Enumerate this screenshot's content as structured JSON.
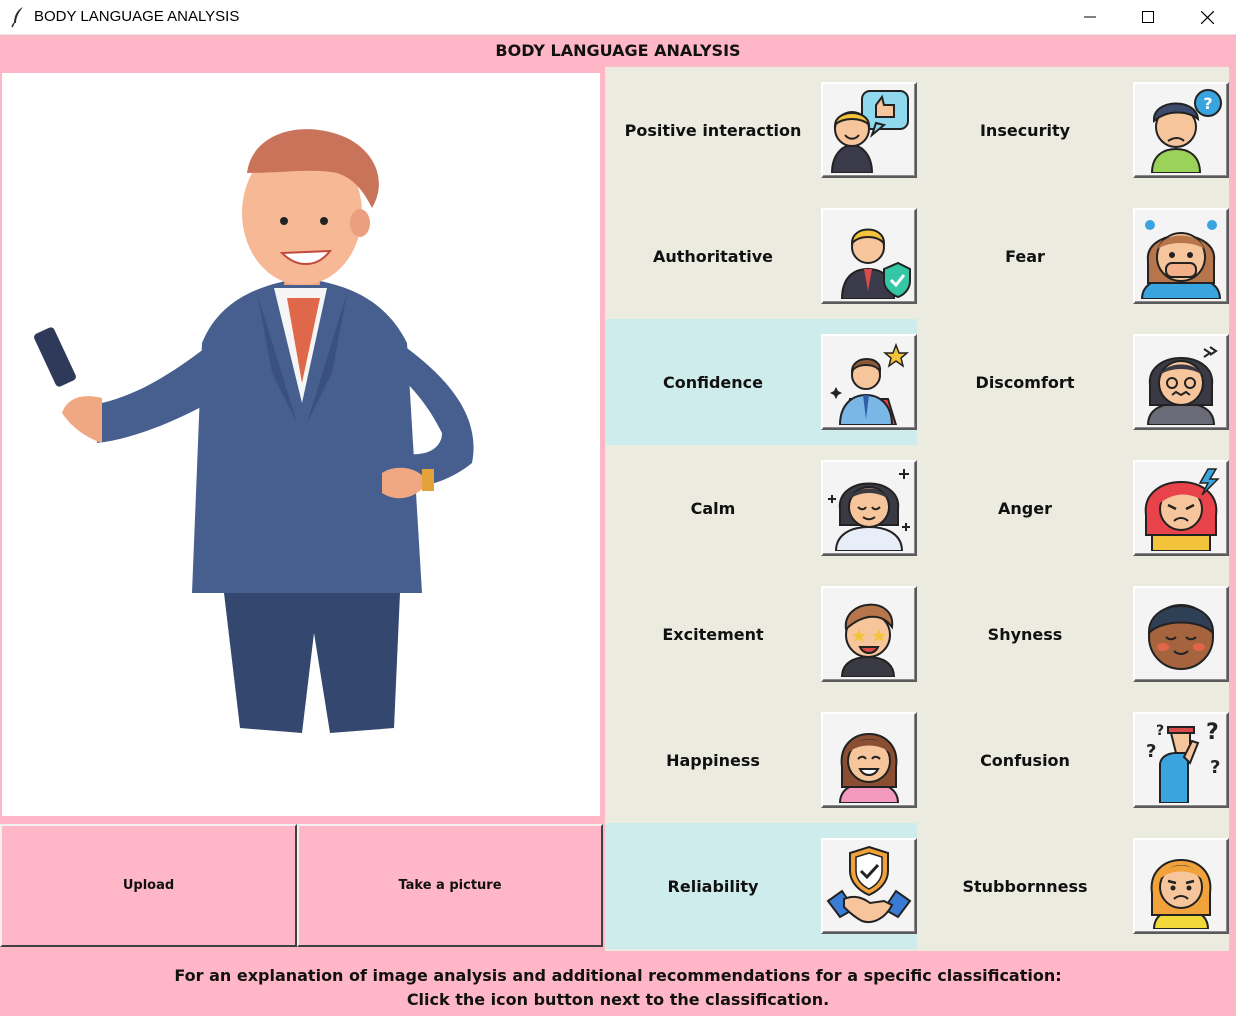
{
  "window": {
    "title": "BODY LANGUAGE ANALYSIS"
  },
  "app": {
    "header": "BODY LANGUAGE ANALYSIS"
  },
  "image_panel": {
    "icon": "businessman-illustration"
  },
  "buttons": {
    "upload": "Upload",
    "take_picture": "Take a picture"
  },
  "classifications": [
    {
      "label": "Positive interaction",
      "icon": "thumbs-up-person-icon",
      "highlighted": false
    },
    {
      "label": "Insecurity",
      "icon": "question-person-icon",
      "highlighted": false
    },
    {
      "label": "Authoritative",
      "icon": "shield-businessman-icon",
      "highlighted": false
    },
    {
      "label": "Fear",
      "icon": "scared-girl-icon",
      "highlighted": false
    },
    {
      "label": "Confidence",
      "icon": "star-businessman-icon",
      "highlighted": true
    },
    {
      "label": "Discomfort",
      "icon": "uneasy-woman-icon",
      "highlighted": false
    },
    {
      "label": "Calm",
      "icon": "meditating-girl-icon",
      "highlighted": false
    },
    {
      "label": "Anger",
      "icon": "angry-woman-icon",
      "highlighted": false
    },
    {
      "label": "Excitement",
      "icon": "star-eyed-boy-icon",
      "highlighted": false
    },
    {
      "label": "Shyness",
      "icon": "blushing-face-icon",
      "highlighted": false
    },
    {
      "label": "Happiness",
      "icon": "smiling-woman-icon",
      "highlighted": false
    },
    {
      "label": "Confusion",
      "icon": "confused-man-icon",
      "highlighted": false
    },
    {
      "label": "Reliability",
      "icon": "handshake-shield-icon",
      "highlighted": true
    },
    {
      "label": "Stubbornness",
      "icon": "frowning-girl-icon",
      "highlighted": false
    }
  ],
  "footer": {
    "line1": "For an explanation of image analysis and additional recommendations for a specific classification:",
    "line2": "Click the icon button next to the classification."
  },
  "colors": {
    "background": "#ffb6c6",
    "panel": "#ecebdf",
    "highlight": "#cfecec"
  }
}
